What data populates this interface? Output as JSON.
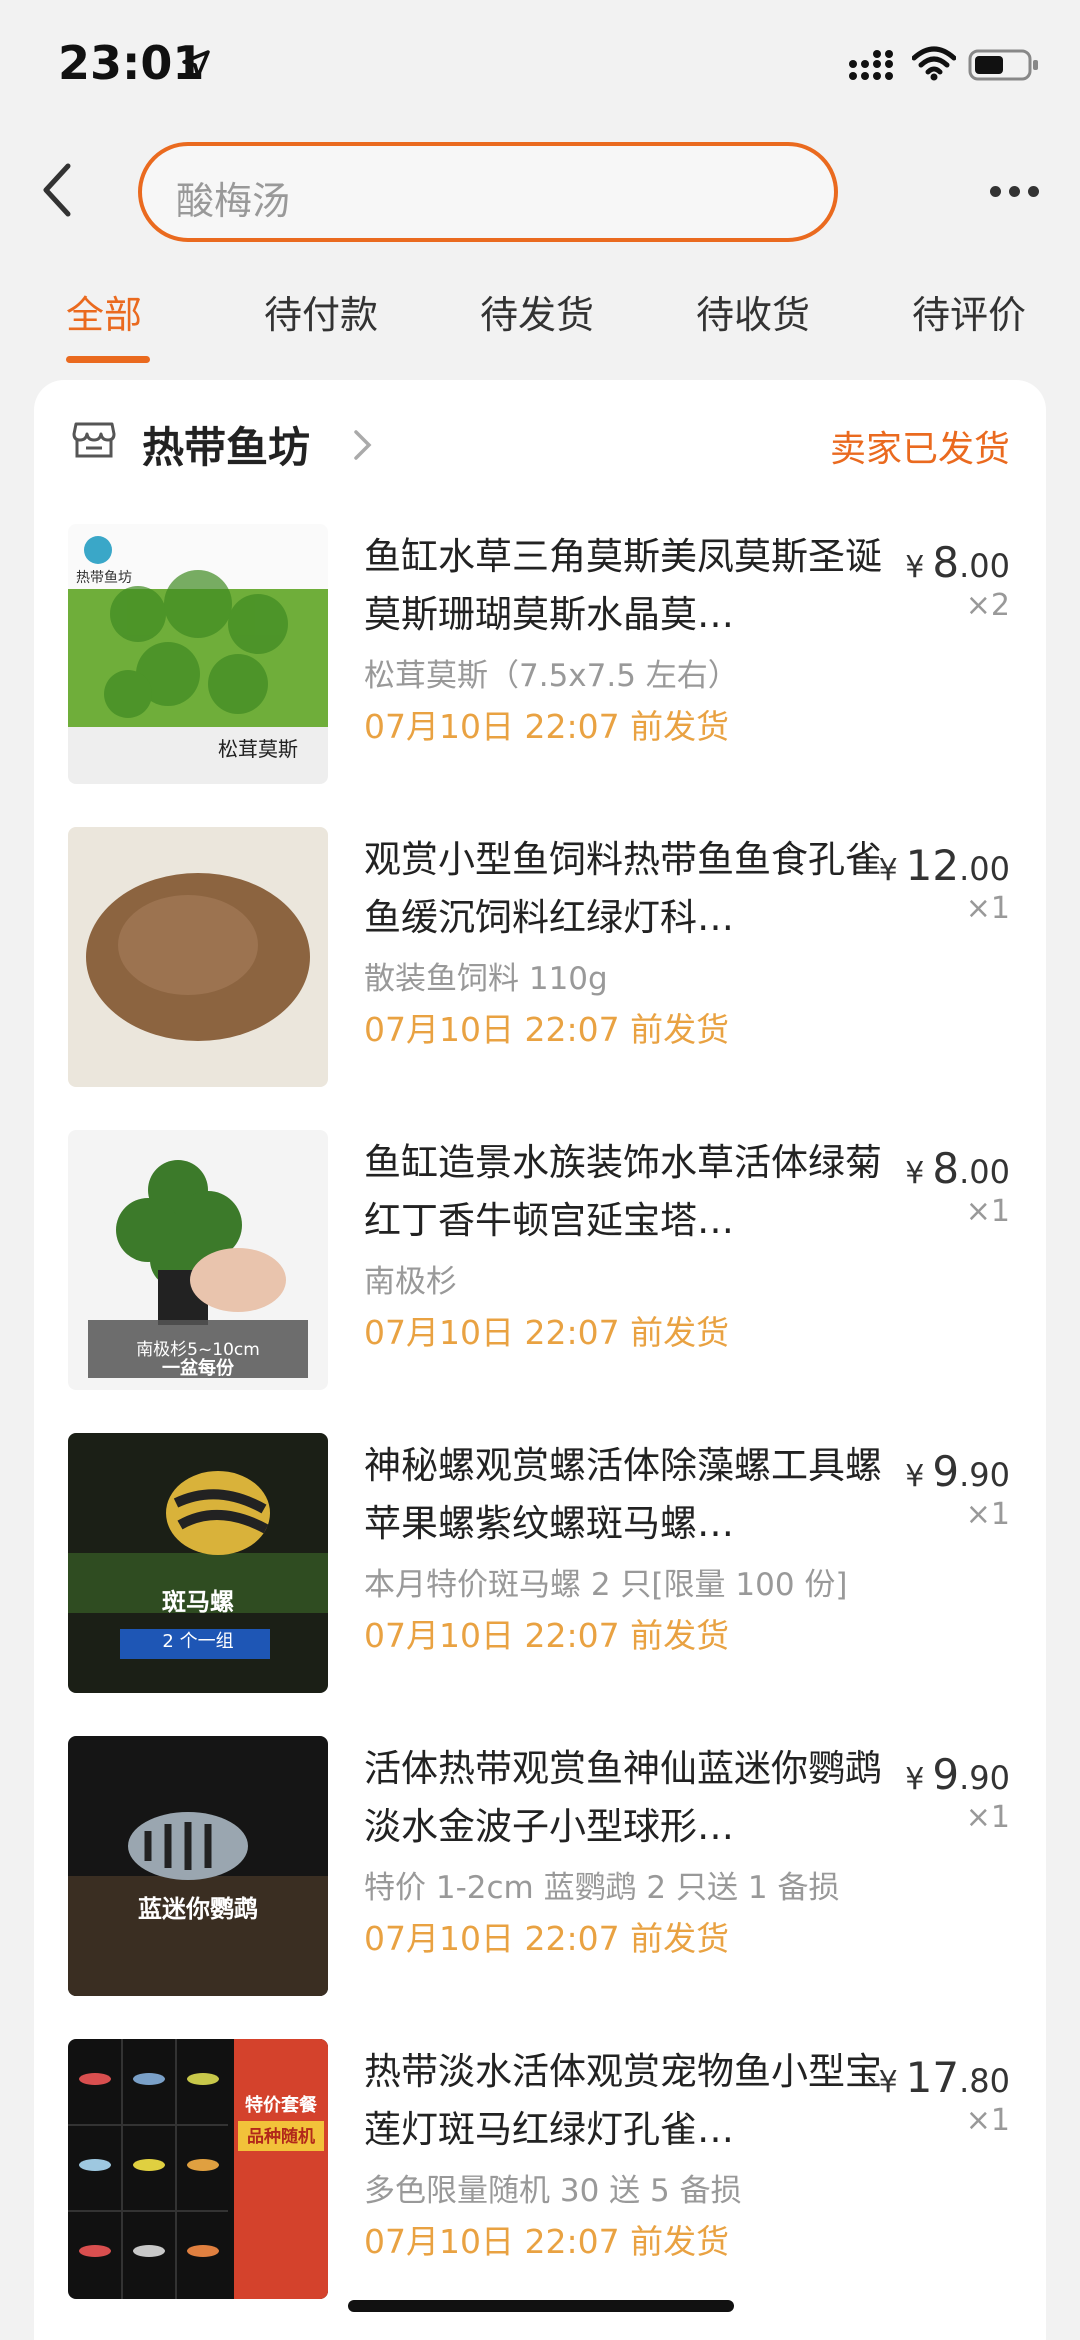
{
  "status_bar": {
    "time": "23:01"
  },
  "search": {
    "value": "酸梅汤"
  },
  "tabs": [
    {
      "label": "全部",
      "active": true
    },
    {
      "label": "待付款"
    },
    {
      "label": "待发货"
    },
    {
      "label": "待收货"
    },
    {
      "label": "待评价"
    }
  ],
  "shop": {
    "name": "热带鱼坊",
    "status": "卖家已发货"
  },
  "items": [
    {
      "title": "鱼缸水草三角莫斯美凤莫斯圣诞莫斯珊瑚莫斯水晶莫…",
      "variant": "松茸莫斯（7.5x7.5 左右）",
      "ship": "07月10日 22:07 前发货",
      "currency": "¥",
      "price_int": "8",
      "price_dec": ".00",
      "qty": "×2",
      "thumb_text": "热带鱼坊",
      "thumb_text2": "松茸莫斯"
    },
    {
      "title": "观赏小型鱼饲料热带鱼鱼食孔雀鱼缓沉饲料红绿灯科…",
      "variant": "散装鱼饲料 110g",
      "ship": "07月10日 22:07 前发货",
      "currency": "¥",
      "price_int": "12",
      "price_dec": ".00",
      "qty": "×1"
    },
    {
      "title": "鱼缸造景水族装饰水草活体绿菊红丁香牛顿宫延宝塔…",
      "variant": "南极杉",
      "ship": "07月10日 22:07 前发货",
      "currency": "¥",
      "price_int": "8",
      "price_dec": ".00",
      "qty": "×1",
      "thumb_text": "南极杉5~10cm",
      "thumb_text2": "一盆每份"
    },
    {
      "title": "神秘螺观赏螺活体除藻螺工具螺苹果螺紫纹螺斑马螺…",
      "variant": "本月特价斑马螺 2 只[限量 100 份]",
      "ship": "07月10日 22:07 前发货",
      "currency": "¥",
      "price_int": "9",
      "price_dec": ".90",
      "qty": "×1",
      "thumb_text": "斑马螺",
      "thumb_text2": "2 个一组"
    },
    {
      "title": "活体热带观赏鱼神仙蓝迷你鹦鹉淡水金波子小型球形…",
      "variant": "特价 1-2cm 蓝鹦鹉 2 只送 1 备损",
      "ship": "07月10日 22:07 前发货",
      "currency": "¥",
      "price_int": "9",
      "price_dec": ".90",
      "qty": "×1",
      "thumb_text": "蓝迷你鹦鹉"
    },
    {
      "title": "热带淡水活体观赏宠物鱼小型宝莲灯斑马红绿灯孔雀…",
      "variant": "多色限量随机 30 送 5 备损",
      "ship": "07月10日 22:07 前发货",
      "currency": "¥",
      "price_int": "17",
      "price_dec": ".80",
      "qty": "×1",
      "thumb_text": "特价套餐",
      "thumb_text2": "品种随机"
    }
  ],
  "colors": {
    "accent": "#ea6a1f",
    "ship": "#e9a242"
  }
}
